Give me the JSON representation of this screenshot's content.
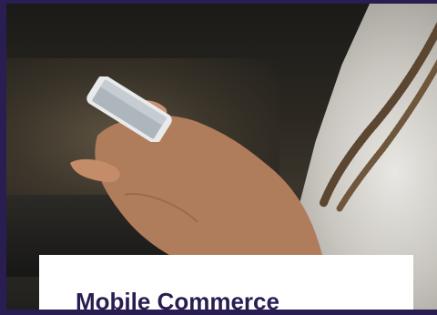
{
  "card": {
    "title": "Mobile Commerce"
  },
  "hero_image": {
    "icon": "hands-holding-smartphone-photo"
  },
  "colors": {
    "background": "#2a1d52",
    "card": "#ffffff",
    "title_text": "#2a1d52"
  }
}
